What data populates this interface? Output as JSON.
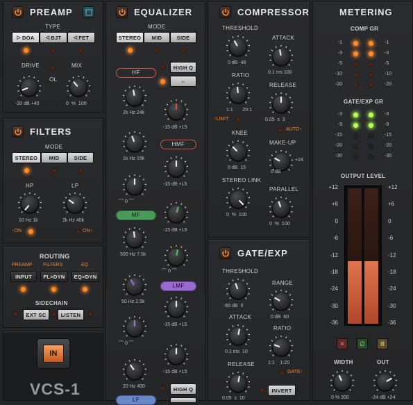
{
  "preamp": {
    "title": "PREAMP",
    "type_label": "TYPE",
    "types": [
      "DOA",
      "BJT",
      "FET"
    ],
    "drive_label": "DRIVE",
    "drive_min": "-20",
    "drive_unit": "dB",
    "drive_max": "+40",
    "ol_label": "OL",
    "mix_label": "MIX",
    "mix_min": "0",
    "mix_unit": "%",
    "mix_max": "100"
  },
  "filters": {
    "title": "FILTERS",
    "mode_label": "MODE",
    "modes": [
      "STEREO",
      "MID",
      "SIDE"
    ],
    "hp_label": "HP",
    "hp_min": "10",
    "hp_unit": "Hz",
    "hp_max": "1k",
    "lp_label": "LP",
    "lp_min": "2k",
    "lp_unit": "Hz",
    "lp_max": "40k",
    "hp_on": "ON",
    "lp_on": "ON"
  },
  "routing": {
    "title": "ROUTING",
    "cols": [
      "PREAMP",
      "FILTERS",
      "EQ"
    ],
    "buttons": [
      "INPUT",
      "FL>DYN",
      "EQ>DYN"
    ],
    "sidechain_label": "SIDECHAIN",
    "sc_buttons": [
      "EXT SC",
      "LISTEN"
    ]
  },
  "brand": {
    "in_label": "IN",
    "logo": "VCS-1"
  },
  "equalizer": {
    "title": "EQUALIZER",
    "mode_label": "MODE",
    "modes": [
      "STEREO",
      "MID",
      "SIDE"
    ],
    "hf": "HF",
    "hmf": "HMF",
    "mf": "MF",
    "lmf": "LMF",
    "lf": "LF",
    "high_q": "HIGH Q",
    "hf_freq": [
      "2k",
      "Hz",
      "24k"
    ],
    "hmf_freq": [
      "1k",
      "Hz",
      "15k"
    ],
    "mf_freq": [
      "500",
      "Hz",
      "7.5k"
    ],
    "lmf_freq": [
      "50",
      "Hz",
      "2.5k"
    ],
    "lf_freq": [
      "20",
      "Hz",
      "400"
    ],
    "gain": [
      "-15",
      "dB",
      "+15"
    ],
    "q_zero": "0"
  },
  "compressor": {
    "title": "COMPRESSOR",
    "threshold": "THRESHOLD",
    "thr_range": [
      "0",
      "dB",
      "-48"
    ],
    "attack": "ATTACK",
    "att_range": [
      "0.1",
      "ms",
      "100"
    ],
    "ratio": "RATIO",
    "ratio_range": [
      "1:1",
      "20:1"
    ],
    "release": "RELEASE",
    "rel_range": [
      "0.05",
      "s",
      "3"
    ],
    "limit": "LIMIT",
    "auto": "AUTO",
    "knee": "KNEE",
    "knee_range": [
      "0",
      "dB",
      "15"
    ],
    "makeup": "MAKE-UP",
    "makeup_range": [
      "0",
      "dB",
      "+24"
    ],
    "stereo_link": "STEREO LINK",
    "sl_range": [
      "0",
      "%",
      "100"
    ],
    "parallel": "PARALLEL",
    "par_range": [
      "0",
      "%",
      "100"
    ]
  },
  "gate": {
    "title": "GATE/EXP",
    "threshold": "THRESHOLD",
    "thr_range": [
      "-60",
      "dB",
      "0"
    ],
    "range": "RANGE",
    "range_range": [
      "0",
      "dB",
      "60"
    ],
    "attack": "ATTACK",
    "att_range": [
      "0.1",
      "ms",
      "10"
    ],
    "ratio": "RATIO",
    "ratio_range": [
      "1:1",
      "1:20"
    ],
    "release": "RELEASE",
    "rel_range": [
      "0.05",
      "s",
      "10"
    ],
    "gate_label": "GATE",
    "invert": "INVERT"
  },
  "metering": {
    "title": "METERING",
    "comp_gr": "COMP GR",
    "comp_scale": [
      "-1",
      "-3",
      "-5",
      "-10",
      "-20"
    ],
    "gate_gr": "GATE/EXP GR",
    "gate_scale": [
      "-3",
      "-9",
      "-15",
      "-20",
      "-30"
    ],
    "output_level": "OUTPUT LEVEL",
    "out_scale": [
      "+12",
      "+6",
      "0",
      "-6",
      "-12",
      "-18",
      "-24",
      "-30",
      "-36"
    ],
    "width": "WIDTH",
    "width_range": [
      "0",
      "%",
      "300"
    ],
    "out": "OUT",
    "out_range": [
      "-24",
      "dB",
      "+24"
    ]
  },
  "colors": {
    "accent": "#ff8a2a",
    "led_green": "#b8ff50",
    "meter_fill": "#d9694a"
  }
}
